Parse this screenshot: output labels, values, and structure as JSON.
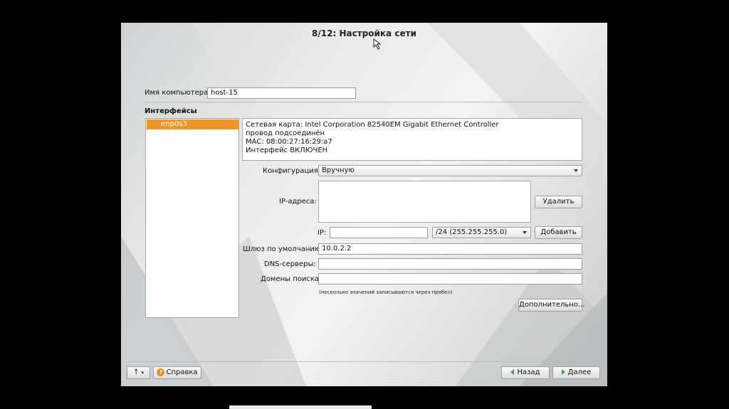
{
  "window": {
    "title": "8/12: Настройка сети"
  },
  "hostname": {
    "label": "Имя компьютера:",
    "value": "host-15"
  },
  "interfaces": {
    "heading": "Интерфейсы",
    "items": [
      {
        "label": "enp0s3",
        "selected": true
      }
    ]
  },
  "details": {
    "lines": [
      "Сетевая карта: Intel Corporation 82540EM Gigabit Ethernet Controller",
      "провод подсоединён",
      "MAC: 08:00:27:16:29:a7",
      "Интерфейс ВКЛЮЧЕН"
    ]
  },
  "config": {
    "label": "Конфигурация:",
    "value": "Вручную"
  },
  "ip_list": {
    "label": "IP-адреса:",
    "delete_label": "Удалить"
  },
  "ip_input": {
    "label": "IP:",
    "value": "",
    "mask": "/24 (255.255.255.0)",
    "add_label": "Добавить"
  },
  "gateway": {
    "label": "Шлюз по умолчанию:",
    "value": "10.0.2.2"
  },
  "dns": {
    "label": "DNS-серверы:",
    "value": ""
  },
  "search": {
    "label": "Домены поиска:",
    "value": ""
  },
  "hint": "(несколько значений записываются через пробел)",
  "advanced_label": "Дополнительно...",
  "footer": {
    "up_label": "↑",
    "help_label": "Справка",
    "back_label": "Назад",
    "next_label": "Далее"
  },
  "colors": {
    "accent": "#f39526",
    "background": "#000000"
  }
}
